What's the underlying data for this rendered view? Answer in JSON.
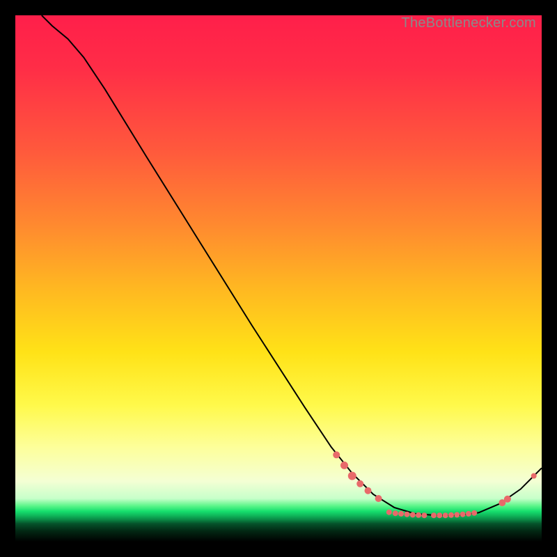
{
  "watermark": {
    "text": "TheBottlenecker.com"
  },
  "colors": {
    "curve": "#000000",
    "dot_fill": "#e86a6a",
    "dot_stroke": "#b34242",
    "gradient_top": "#ff1f4a",
    "gradient_mid": "#fff94a",
    "gradient_green": "#17e06e",
    "background": "#000000"
  },
  "chart_data": {
    "type": "line",
    "title": "",
    "xlabel": "",
    "ylabel": "",
    "xlim": [
      0,
      100
    ],
    "ylim": [
      0,
      100
    ],
    "note": "No axes or tick labels are rendered; x/y are normalized percentages of plot extent. y=100 at top, y≈5 is the green minimum band.",
    "curve": [
      {
        "x": 5,
        "y": 100
      },
      {
        "x": 7,
        "y": 98
      },
      {
        "x": 10,
        "y": 95.5
      },
      {
        "x": 13,
        "y": 92
      },
      {
        "x": 17,
        "y": 86
      },
      {
        "x": 25,
        "y": 73
      },
      {
        "x": 35,
        "y": 57
      },
      {
        "x": 45,
        "y": 41
      },
      {
        "x": 55,
        "y": 25.5
      },
      {
        "x": 60,
        "y": 18
      },
      {
        "x": 64,
        "y": 13
      },
      {
        "x": 68,
        "y": 9
      },
      {
        "x": 72,
        "y": 6.5
      },
      {
        "x": 76,
        "y": 5.3
      },
      {
        "x": 80,
        "y": 5
      },
      {
        "x": 84,
        "y": 5
      },
      {
        "x": 88,
        "y": 5.5
      },
      {
        "x": 92,
        "y": 7.2
      },
      {
        "x": 96,
        "y": 10
      },
      {
        "x": 100,
        "y": 14
      }
    ],
    "highlight_clusters": [
      {
        "x": 61,
        "y": 16.5,
        "r": 5
      },
      {
        "x": 62.5,
        "y": 14.5,
        "r": 5.5
      },
      {
        "x": 64,
        "y": 12.5,
        "r": 6
      },
      {
        "x": 65.5,
        "y": 11,
        "r": 5
      },
      {
        "x": 67,
        "y": 9.7,
        "r": 5
      },
      {
        "x": 69,
        "y": 8.2,
        "r": 5
      },
      {
        "x": 71,
        "y": 5.6,
        "r": 4
      },
      {
        "x": 72.2,
        "y": 5.4,
        "r": 4
      },
      {
        "x": 73.3,
        "y": 5.3,
        "r": 4
      },
      {
        "x": 74.4,
        "y": 5.2,
        "r": 4
      },
      {
        "x": 75.5,
        "y": 5.1,
        "r": 4
      },
      {
        "x": 76.6,
        "y": 5.05,
        "r": 4
      },
      {
        "x": 77.7,
        "y": 5.0,
        "r": 4
      },
      {
        "x": 79.5,
        "y": 5.0,
        "r": 4
      },
      {
        "x": 80.6,
        "y": 5.0,
        "r": 4
      },
      {
        "x": 81.7,
        "y": 5.0,
        "r": 4
      },
      {
        "x": 82.8,
        "y": 5.05,
        "r": 4
      },
      {
        "x": 83.9,
        "y": 5.1,
        "r": 4
      },
      {
        "x": 85.0,
        "y": 5.2,
        "r": 4
      },
      {
        "x": 86.1,
        "y": 5.3,
        "r": 4
      },
      {
        "x": 87.2,
        "y": 5.45,
        "r": 4
      },
      {
        "x": 92.5,
        "y": 7.4,
        "r": 5
      },
      {
        "x": 93.5,
        "y": 8.1,
        "r": 5
      },
      {
        "x": 98.5,
        "y": 12.5,
        "r": 4
      }
    ]
  }
}
